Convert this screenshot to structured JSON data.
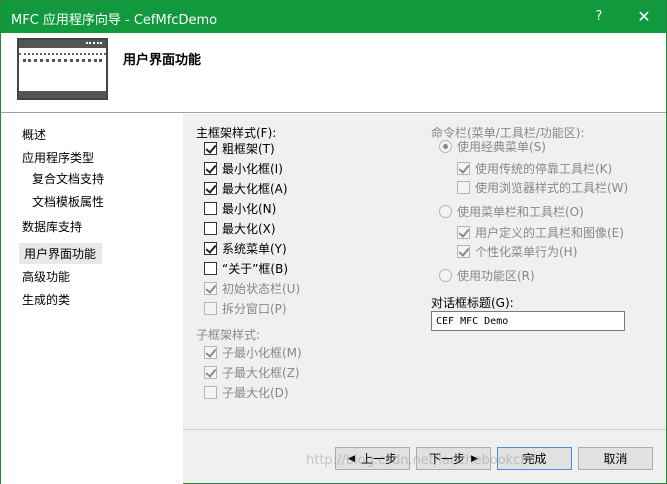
{
  "window": {
    "title": "MFC 应用程序向导 - CefMfcDemo",
    "help": "?",
    "close": "✕"
  },
  "banner": {
    "heading": "用户界面功能"
  },
  "nav": {
    "items": [
      {
        "label": "概述"
      },
      {
        "label": "应用程序类型"
      },
      {
        "label": "复合文档支持"
      },
      {
        "label": "文档模板属性"
      },
      {
        "label": "数据库支持"
      },
      {
        "label": "用户界面功能"
      },
      {
        "label": "高级功能"
      },
      {
        "label": "生成的类"
      }
    ]
  },
  "main_frame": {
    "label": "主框架样式(F):",
    "options": [
      {
        "label": "粗框架(T)",
        "checked": true,
        "enabled": true
      },
      {
        "label": "最小化框(I)",
        "checked": true,
        "enabled": true
      },
      {
        "label": "最大化框(A)",
        "checked": true,
        "enabled": true
      },
      {
        "label": "最小化(N)",
        "checked": false,
        "enabled": true
      },
      {
        "label": "最大化(X)",
        "checked": false,
        "enabled": true
      },
      {
        "label": "系统菜单(Y)",
        "checked": true,
        "enabled": true
      },
      {
        "label": "“关于”框(B)",
        "checked": false,
        "enabled": true
      },
      {
        "label": "初始状态栏(U)",
        "checked": true,
        "enabled": false
      },
      {
        "label": "拆分窗口(P)",
        "checked": false,
        "enabled": false
      }
    ]
  },
  "child_frame": {
    "label": "子框架样式:",
    "options": [
      {
        "label": "子最小化框(M)",
        "checked": true
      },
      {
        "label": "子最大化框(Z)",
        "checked": true
      },
      {
        "label": "子最大化(D)",
        "checked": false
      }
    ]
  },
  "command_bar": {
    "label": "命令栏(菜单/工具栏/功能区):",
    "classic_menu": "使用经典菜单(S)",
    "classic_dock_toolbar": "使用传统的停靠工具栏(K)",
    "classic_browser_toolbar": "使用浏览器样式的工具栏(W)",
    "menubar_toolbar": "使用菜单栏和工具栏(O)",
    "user_toolbar_images": "用户定义的工具栏和图像(E)",
    "personalized_menu": "个性化菜单行为(H)",
    "ribbon": "使用功能区(R)"
  },
  "dialog_title": {
    "label": "对话框标题(G):",
    "value": "CEF MFC Demo"
  },
  "buttons": {
    "prev": "上一步",
    "next": "下一步",
    "finish": "完成",
    "cancel": "取消"
  },
  "watermark": "http://blog.csdn.net/lanchebookcliff"
}
